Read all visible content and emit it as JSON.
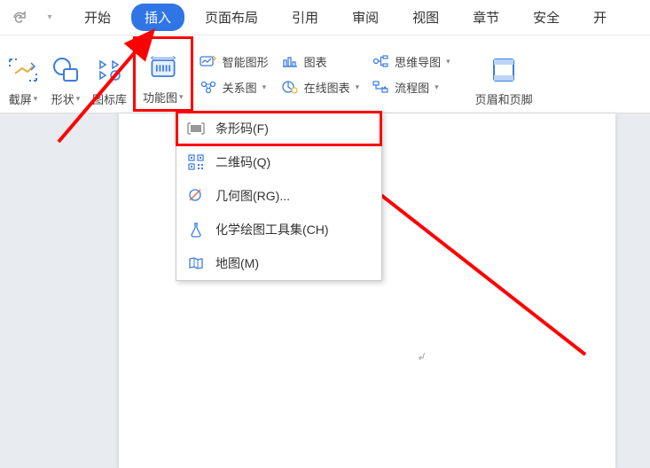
{
  "tabs": {
    "start": "开始",
    "insert": "插入",
    "pagelayout": "页面布局",
    "reference": "引用",
    "review": "审阅",
    "view": "视图",
    "chapter": "章节",
    "security": "安全",
    "feature": "开"
  },
  "ribbon": {
    "screenshot": "截屏",
    "shape": "形状",
    "iconlib": "图标库",
    "funcimg": "功能图",
    "smartgraphic": "智能图形",
    "relation": "关系图",
    "chart": "图表",
    "onlinechart": "在线图表",
    "mindmap": "思维导图",
    "flowchart": "流程图",
    "headerfooter": "页眉和页脚"
  },
  "dropdown": {
    "items": [
      {
        "label": "条形码(F)",
        "icon": "barcode-icon"
      },
      {
        "label": "二维码(Q)",
        "icon": "qrcode-icon"
      },
      {
        "label": "几何图(RG)...",
        "icon": "geometry-icon"
      },
      {
        "label": "化学绘图工具集(CH)",
        "icon": "chemistry-icon"
      },
      {
        "label": "地图(M)",
        "icon": "map-icon"
      }
    ]
  },
  "colors": {
    "accent": "#3075e6",
    "highlight": "#ff0000"
  }
}
